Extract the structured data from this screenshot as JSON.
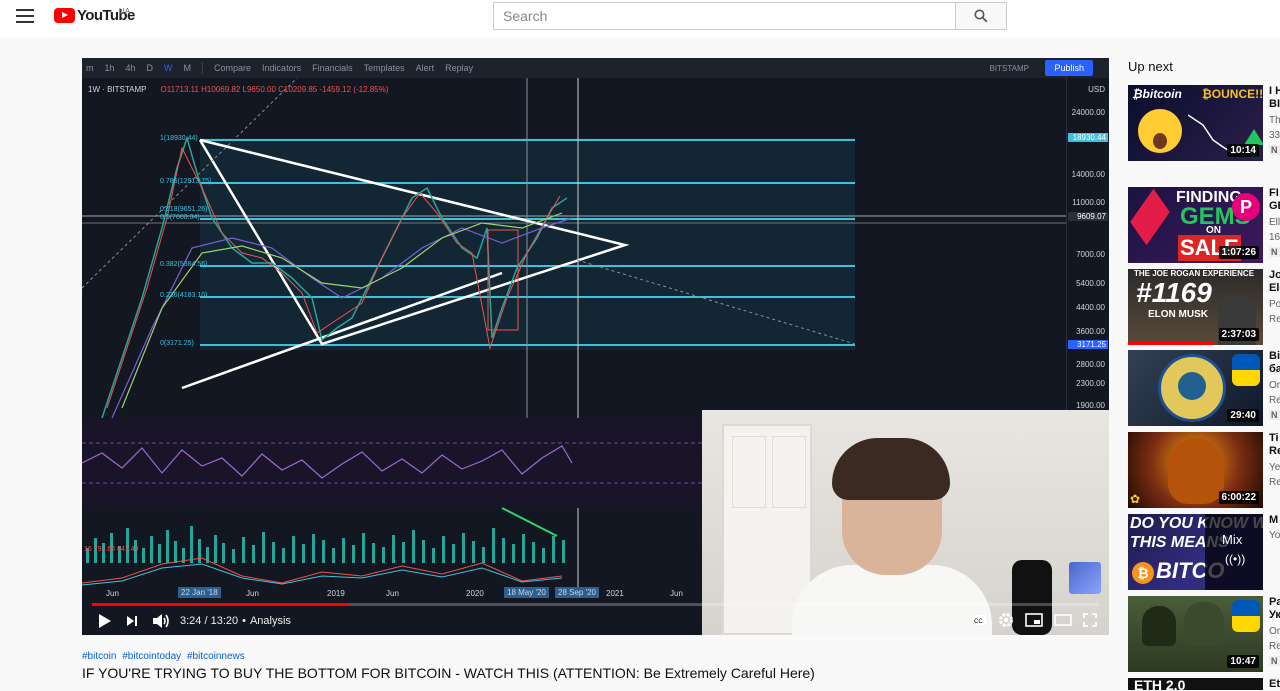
{
  "header": {
    "logo_text": "YouTube",
    "country": "UA",
    "search_placeholder": "Search"
  },
  "tradingview": {
    "toolbar": [
      "m",
      "1h",
      "4h",
      "D",
      "W",
      "M",
      "Compare",
      "Indicators",
      "Financials",
      "Templates",
      "Alert",
      "Replay"
    ],
    "exchange": "BITSTAMP",
    "publish": "Publish",
    "legend_symbol": "1W · BITSTAMP",
    "legend_ohlc": "O11713.11 H10069.82 L9650.00 C10209.85 -1459.12 (-12.85%)",
    "currency": "USD",
    "price_labels": [
      "24000.00",
      "18930.44",
      "14000.00",
      "11000.00",
      "9609.07",
      "7000.00",
      "5400.00",
      "4400.00",
      "3600.00",
      "3171.25",
      "2800.00",
      "2300.00",
      "1900.00"
    ],
    "fib_labels": [
      "1(18930.44)",
      "0.786(12913.75)",
      "0.618(9651.26)",
      "0.5(7000.34)",
      "0.382(5384.56)",
      "0.236(4183.10)",
      "0(3171.25)"
    ],
    "time_labels": [
      "Jun",
      "22 Jan '18",
      "Jun",
      "2019",
      "Jun",
      "2020",
      "18 May '20",
      "28 Sep '20",
      "2021",
      "Jun"
    ],
    "volume_legend": "16 791.64 641.48"
  },
  "player": {
    "time": "3:24 / 13:20",
    "chapter": "Analysis",
    "progress_fraction": 0.255
  },
  "video": {
    "hashtags": [
      "#bitcoin",
      "#bitcointoday",
      "#bitcoinnews"
    ],
    "title": "IF YOU'RE TRYING TO BUY THE BOTTOM FOR BITCOIN - WATCH THIS (ATTENTION: Be Extremely Careful Here)"
  },
  "sidebar": {
    "heading": "Up next",
    "items": [
      {
        "title": "I H",
        "title2": "BI",
        "meta1": "Th",
        "meta2": "33",
        "badge": "N",
        "duration": "10:14",
        "thumb_text": "bitcoin BOUNCE!!"
      },
      {
        "title": "FI",
        "title2": "GE",
        "meta1": "Ell",
        "meta2": "16",
        "badge": "N",
        "duration": "1:07:26",
        "thumb_text": "FINDING GEMS ON SALE"
      },
      {
        "title": "Jo",
        "title2": "Ele",
        "meta1": "Po",
        "meta2": "Re",
        "badge": "",
        "duration": "2:37:03",
        "thumb_text": "THE JOE ROGAN EXPERIENCE #1169 ELON MUSK"
      },
      {
        "title": "Bi",
        "title2": "ба",
        "meta1": "Or",
        "meta2": "Re",
        "badge": "N",
        "duration": "29:40",
        "thumb_text": ""
      },
      {
        "title": "Ti",
        "title2": "Re",
        "meta1": "Ye",
        "meta2": "Re",
        "badge": "",
        "duration": "6:00:22",
        "thumb_text": ""
      },
      {
        "title": "M",
        "title2": "",
        "meta1": "Yo",
        "meta2": "",
        "badge": "",
        "duration": "",
        "thumb_text": "DO YOU KNOW WHAT THIS MEANS BITCOIN",
        "mix": "Mix"
      },
      {
        "title": "Ра",
        "title2": "Ук",
        "meta1": "Or",
        "meta2": "Re",
        "badge": "N",
        "duration": "10:47",
        "thumb_text": ""
      },
      {
        "title": "Et",
        "title2": "",
        "meta1": "",
        "meta2": "",
        "badge": "",
        "duration": "",
        "thumb_text": "ETH 2.0"
      }
    ]
  },
  "colors": {
    "brand": "#ff0000",
    "link": "#065fd4",
    "chart_bg": "#131722",
    "fib_line": "#3fc1de",
    "triangle": "#ffffff"
  }
}
